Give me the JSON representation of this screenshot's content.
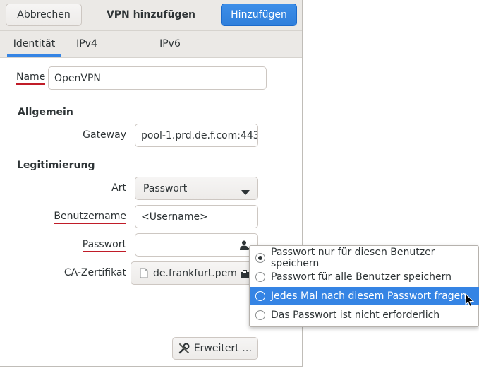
{
  "header": {
    "cancel_label": "Abbrechen",
    "title": "VPN hinzufügen",
    "add_label": "Hinzufügen"
  },
  "tabs": [
    {
      "label": "Identität",
      "active": true
    },
    {
      "label": "IPv4",
      "active": false
    },
    {
      "label": "IPv6",
      "active": false
    }
  ],
  "name": {
    "label": "Name",
    "value": "OpenVPN"
  },
  "general": {
    "heading": "Allgemein",
    "gateway_label": "Gateway",
    "gateway_value": "pool-1.prd.de.f.com:443"
  },
  "auth": {
    "heading": "Legitimierung",
    "type_label": "Art",
    "type_value": "Passwort",
    "username_label": "Benutzername",
    "username_value": "<Username>",
    "password_label": "Passwort",
    "password_value": "",
    "ca_label": "CA-Zertifikat",
    "ca_value": "de.frankfurt.pem"
  },
  "advanced_label": "Erweitert …",
  "password_popover": {
    "options": [
      {
        "label": "Passwort nur für diesen Benutzer speichern",
        "checked": true,
        "highlighted": false
      },
      {
        "label": "Passwort für alle Benutzer speichern",
        "checked": false,
        "highlighted": false
      },
      {
        "label": "Jedes Mal nach diesem Passwort fragen",
        "checked": false,
        "highlighted": true
      },
      {
        "label": "Das Passwort ist nicht erforderlich",
        "checked": false,
        "highlighted": false
      }
    ]
  },
  "colors": {
    "accent": "#3584e4",
    "error_underline": "#c01c28",
    "header_bg": "#ebe9e6"
  }
}
